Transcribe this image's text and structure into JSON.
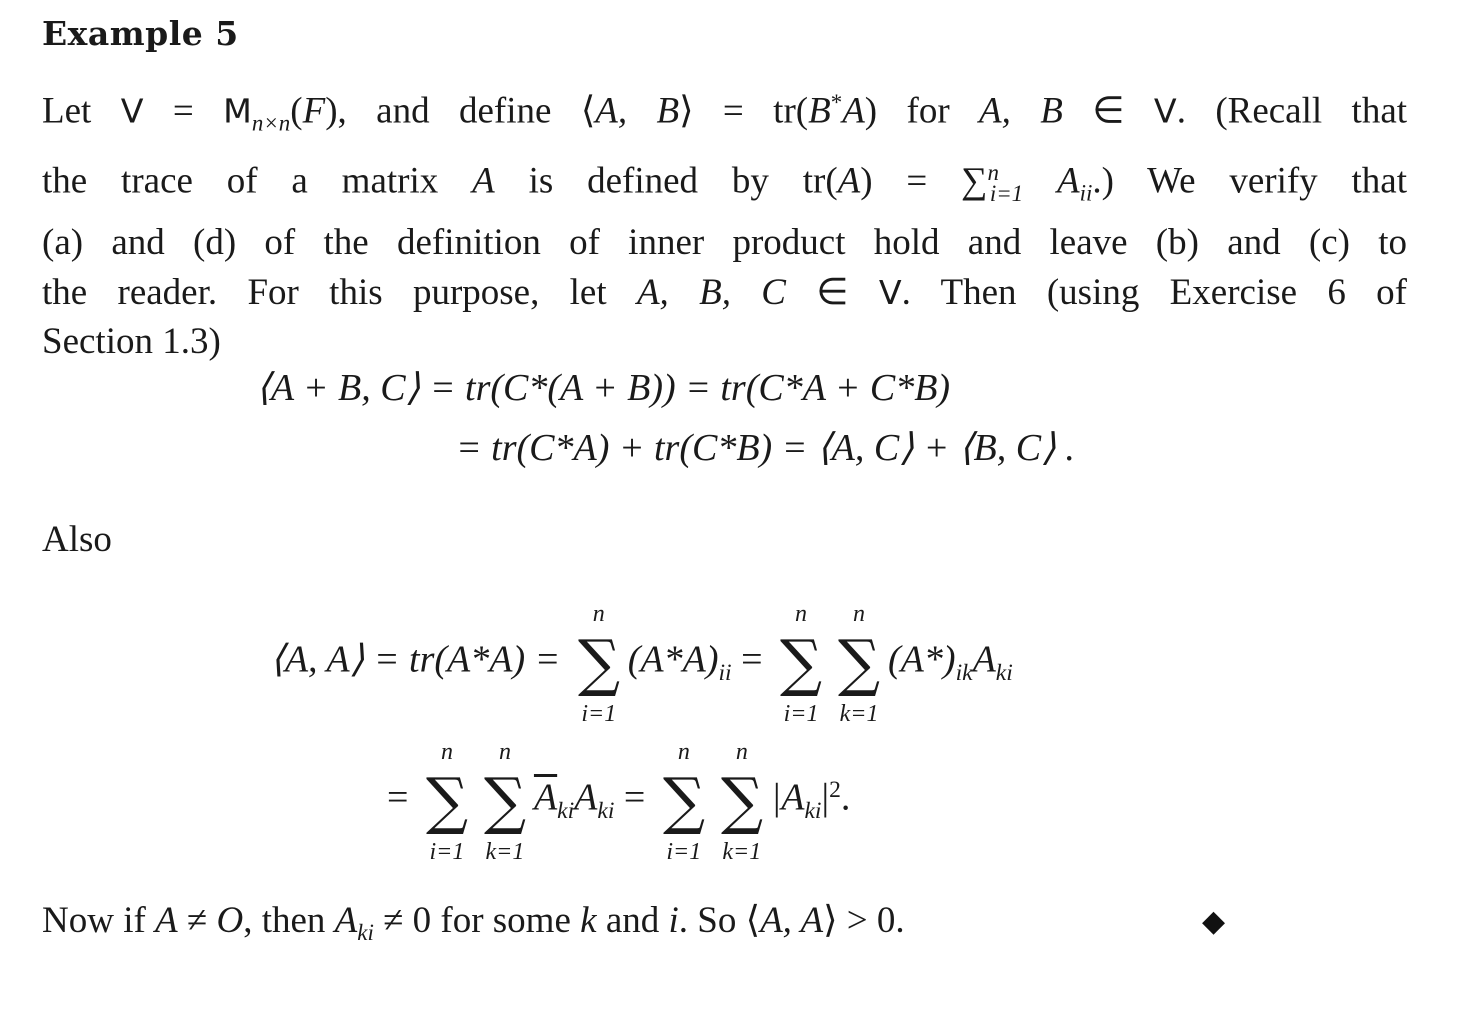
{
  "heading": "Example 5",
  "paragraph": {
    "line1": {
      "t1": "Let ",
      "V": "V",
      "t2": " = ",
      "M": "M",
      "Msub": "n×n",
      "t3": "(",
      "F": "F",
      "t4": "), and define ⟨",
      "AB": "A, B",
      "t5": "⟩ = tr(",
      "B": "B",
      "star": "*",
      "A": "A",
      "t6": ") for ",
      "AB2": "A, B",
      "t7": " ∈ ",
      "V2": "V",
      "t8": ".  (Recall that"
    },
    "line2": {
      "t1": "the trace of a matrix ",
      "A": "A",
      "t2": " is defined by tr(",
      "A2": "A",
      "t3": ") = ∑",
      "sumsup": "n",
      "sumsub": "i=1",
      "t4": " ",
      "Aii": "A",
      "Aiisub": "ii",
      "t5": ".)  We verify that"
    },
    "line3": "(a) and (d) of the definition of inner product hold and leave (b) and (c) to",
    "line4": {
      "t1": "the reader.  For this purpose, let ",
      "ABC": "A, B, C",
      "t2": " ∈ ",
      "V": "V",
      "t3": ".  Then (using Exercise 6 of"
    },
    "line5": "Section 1.3)"
  },
  "equations": {
    "eq1": "⟨A + B, C⟩ = tr(C*(A + B)) = tr(C*A + C*B)",
    "eq2": "= tr(C*A) + tr(C*B) = ⟨A, C⟩ + ⟨B, C⟩ .",
    "eq3": {
      "lhs": "⟨A, A⟩ = tr(A*A) = ",
      "sum_upper": "n",
      "sum_lower_i": "i=1",
      "sum_lower_k": "k=1",
      "term1": "(A*A)",
      "term1_sub": "ii",
      "eqsign": " = ",
      "term2": "(A*)",
      "term2_sub": "ik",
      "term2b": "A",
      "term2b_sub": "ki"
    },
    "eq4": {
      "eqsign": "= ",
      "sum_upper": "n",
      "sum_lower_i": "i=1",
      "sum_lower_k": "k=1",
      "term1a": "A",
      "term1a_sub": "ki",
      "term1b": "A",
      "term1b_sub": "ki",
      "eqsign2": " = ",
      "term2": "|A",
      "term2_sub": "ki",
      "term2_end": "|",
      "term2_sup": "2",
      "period": "."
    }
  },
  "also": "Also",
  "final": {
    "t1": "Now if ",
    "A": "A",
    "t2": " ≠ ",
    "O": "O",
    "t3": ", then ",
    "Aki": "A",
    "Akisub": "ki",
    "t4": " ≠ 0 for some ",
    "k": "k",
    "t5": " and ",
    "i": "i",
    "t6": ". So ⟨",
    "AA": "A, A",
    "t7": "⟩ > 0."
  },
  "qed_symbol": "◆"
}
